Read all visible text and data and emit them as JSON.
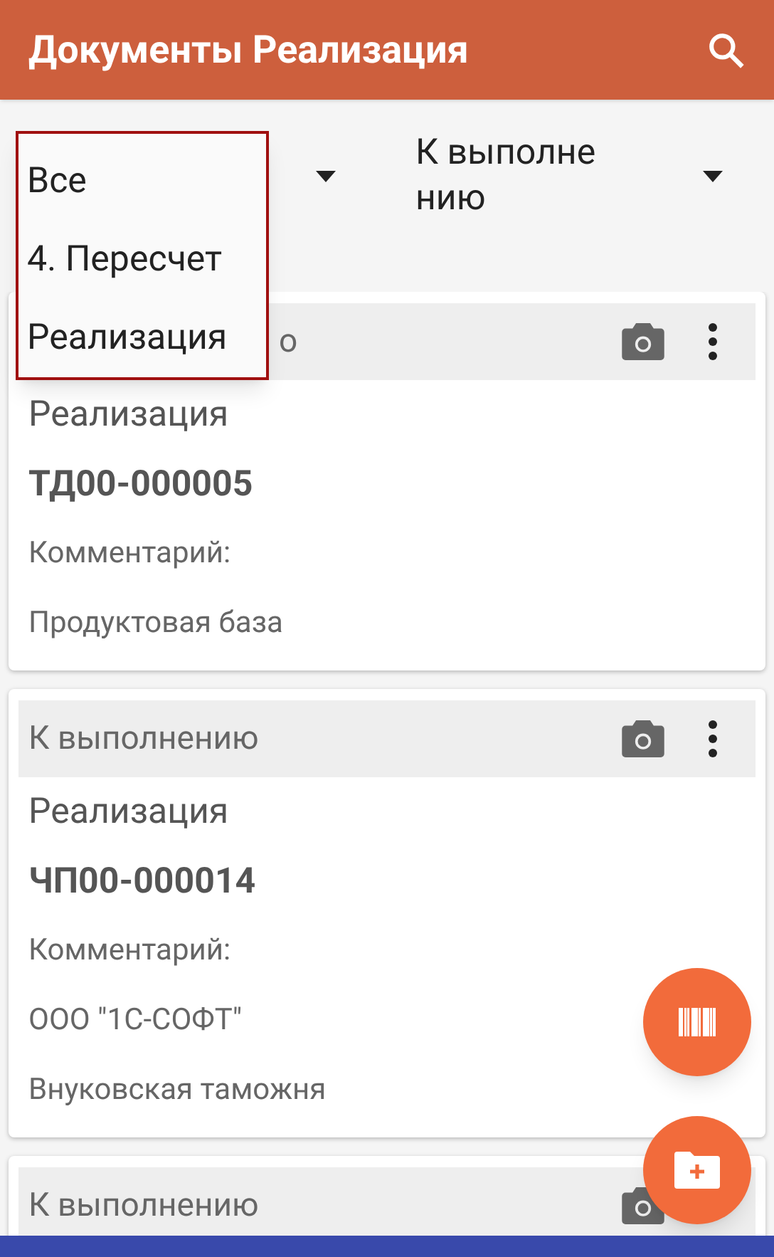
{
  "app_bar": {
    "title": "Документы Реализация"
  },
  "filters": [
    {
      "kind": "select"
    },
    {
      "value": "К выполнению",
      "kind": "select"
    }
  ],
  "dropdown": {
    "options": [
      {
        "label": "Все"
      },
      {
        "label": "4. Пересчет"
      },
      {
        "label": "Реализация"
      }
    ]
  },
  "cards": [
    {
      "status": "о",
      "kind": "under_menu",
      "lines": [
        {
          "text": "Реализация",
          "kind": "type"
        },
        {
          "text": "ТД00-000005",
          "kind": "number"
        },
        {
          "text": "Комментарий:",
          "kind": "plain"
        },
        {
          "text": "Продуктовая база",
          "kind": "plain"
        }
      ]
    },
    {
      "status": "К выполнению",
      "kind": "normal",
      "lines": [
        {
          "text": "Реализация",
          "kind": "type"
        },
        {
          "text": "ЧП00-000014",
          "kind": "number"
        },
        {
          "text": "Комментарий:",
          "kind": "plain"
        },
        {
          "text": "ООО \"1С-СОФТ\"",
          "kind": "plain"
        },
        {
          "text": "Внуковская таможня",
          "kind": "plain"
        }
      ]
    },
    {
      "status": "К выполнению",
      "kind": "under_button"
    }
  ]
}
